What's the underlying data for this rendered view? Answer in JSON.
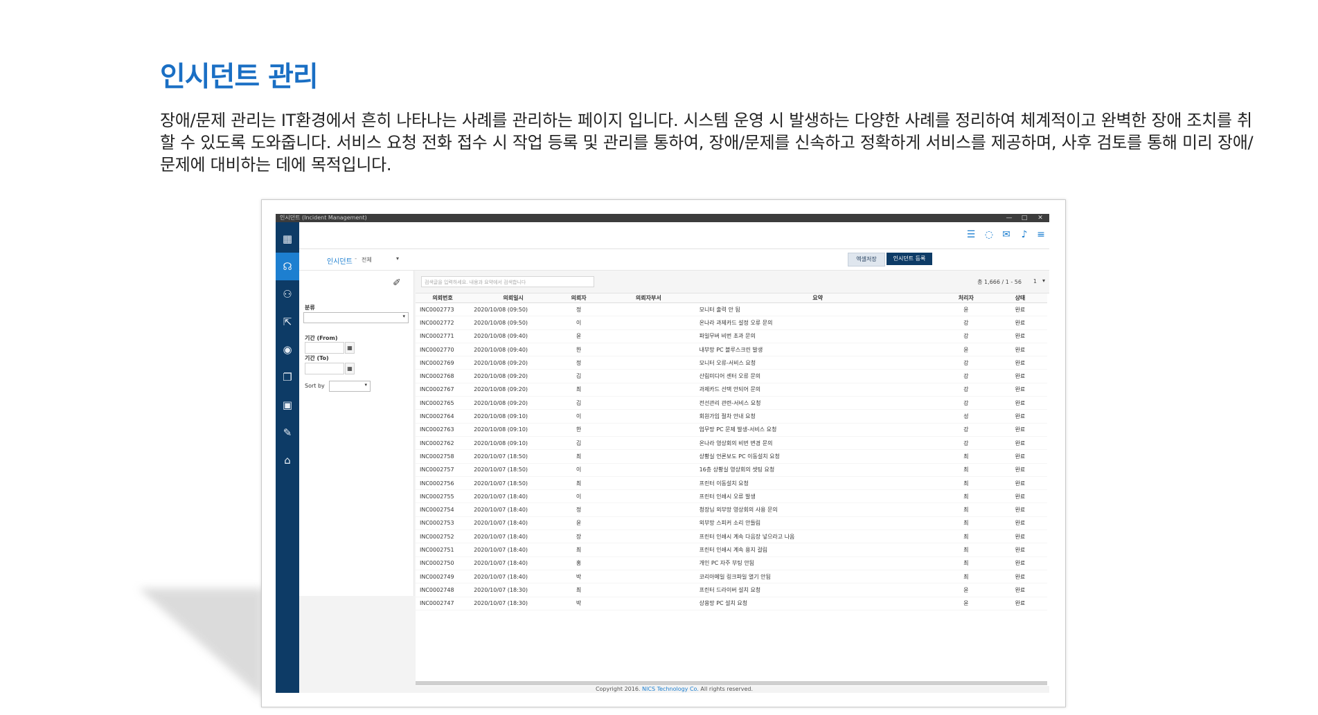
{
  "page": {
    "title": "인시던트 관리",
    "description": "장애/문제 관리는 IT환경에서 흔히 나타나는 사례를 관리하는 페이지 입니다. 시스템 운영 시 발생하는 다양한 사례를 정리하여 체계적이고 완벽한 장애 조치를 취할 수 있도록 도와줍니다. 서비스 요청 전화 접수 시 작업 등록 및 관리를 통하여, 장애/문제를 신속하고 정확하게 서비스를 제공하며, 사후 검토를 통해 미리 장애/ 문제에 대비하는 데에 목적입니다."
  },
  "app": {
    "window_title": "인시던트 (Incident Management)",
    "window_controls": [
      "—",
      "□",
      "✕"
    ],
    "sidebar": [
      {
        "icon": "calendar-icon",
        "glyph": "▦"
      },
      {
        "icon": "headset-icon",
        "glyph": "☊"
      },
      {
        "icon": "users-chat-icon",
        "glyph": "⚇"
      },
      {
        "icon": "external-link-icon",
        "glyph": "⇱"
      },
      {
        "icon": "eye-icon",
        "glyph": "◉"
      },
      {
        "icon": "copy-icon",
        "glyph": "❐"
      },
      {
        "icon": "grid-icon",
        "glyph": "▣"
      },
      {
        "icon": "edit-icon",
        "glyph": "✎"
      },
      {
        "icon": "bank-icon",
        "glyph": "⌂"
      }
    ],
    "top_icons": [
      {
        "icon": "task-list-icon",
        "glyph": "☰"
      },
      {
        "icon": "message-icon",
        "glyph": "◌"
      },
      {
        "icon": "mail-icon",
        "glyph": "✉"
      },
      {
        "icon": "bell-icon",
        "glyph": "♪"
      },
      {
        "icon": "menu-icon",
        "glyph": "≡"
      }
    ],
    "breadcrumb": {
      "main": "인시던트",
      "sep": "-",
      "sub": "전체",
      "caret": "▾"
    },
    "buttons": {
      "excel": "엑셀저장",
      "register": "인시던트 등록"
    },
    "filter": {
      "eraser_glyph": "✐",
      "category_label": "분류",
      "from_label": "기간 (From)",
      "to_label": "기간 (To)",
      "sort_label": "Sort by",
      "calendar_glyph": "▦",
      "caret": "▾"
    },
    "search": {
      "placeholder": "검색글을 입력하세요. 내용과 요약에서 검색합니다"
    },
    "pagination": {
      "info": "총 1,666 / 1 - 56",
      "current": "1",
      "caret": "▾"
    },
    "table": {
      "headers": [
        "의뢰번호",
        "의뢰일시",
        "의뢰자",
        "의뢰자부서",
        "요약",
        "처리자",
        "상태"
      ],
      "rows": [
        [
          "INC0002773",
          "2020/10/08 (09:50)",
          "정",
          "",
          "모니터 출력 안 됨",
          "윤",
          "완료"
        ],
        [
          "INC0002772",
          "2020/10/08 (09:50)",
          "이",
          "",
          "온나라 과제카드 설정 오류 문의",
          "강",
          "완료"
        ],
        [
          "INC0002771",
          "2020/10/08 (09:40)",
          "윤",
          "",
          "파일무버 비번 초과 문의",
          "강",
          "완료"
        ],
        [
          "INC0002770",
          "2020/10/08 (09:40)",
          "한",
          "",
          "내부망 PC 블루스크린 발생",
          "윤",
          "완료"
        ],
        [
          "INC0002769",
          "2020/10/08 (09:20)",
          "정",
          "",
          "모니터 오류-서비스 요청",
          "강",
          "완료"
        ],
        [
          "INC0002768",
          "2020/10/08 (09:20)",
          "김",
          "",
          "산림미디어 센터 오류 문의",
          "강",
          "완료"
        ],
        [
          "INC0002767",
          "2020/10/08 (09:20)",
          "최",
          "",
          "과제카드 선택 안되어 문의",
          "강",
          "완료"
        ],
        [
          "INC0002765",
          "2020/10/08 (09:20)",
          "김",
          "",
          "전선관리 관련-서비스 요청",
          "강",
          "완료"
        ],
        [
          "INC0002764",
          "2020/10/08 (09:10)",
          "이",
          "",
          "회원가입 절차 안내 요청",
          "성",
          "완료"
        ],
        [
          "INC0002763",
          "2020/10/08 (09:10)",
          "한",
          "",
          "업무망 PC 문제 발생-서비스 요청",
          "강",
          "완료"
        ],
        [
          "INC0002762",
          "2020/10/08 (09:10)",
          "김",
          "",
          "온나라 영상회의 비번 변경 문의",
          "강",
          "완료"
        ],
        [
          "INC0002758",
          "2020/10/07 (18:50)",
          "최",
          "",
          "상황실 언론보도 PC 이동설치 요청",
          "최",
          "완료"
        ],
        [
          "INC0002757",
          "2020/10/07 (18:50)",
          "이",
          "",
          "16층 상황실 영상회의 셋팅 요청",
          "최",
          "완료"
        ],
        [
          "INC0002756",
          "2020/10/07 (18:50)",
          "최",
          "",
          "프린터 이동설치 요청",
          "최",
          "완료"
        ],
        [
          "INC0002755",
          "2020/10/07 (18:40)",
          "이",
          "",
          "프린터 인쇄시 오류 발생",
          "최",
          "완료"
        ],
        [
          "INC0002754",
          "2020/10/07 (18:40)",
          "정",
          "",
          "청장님 외부망 영상회의 사용 문의",
          "최",
          "완료"
        ],
        [
          "INC0002753",
          "2020/10/07 (18:40)",
          "윤",
          "",
          "외부망 스피커 소리 안들림",
          "최",
          "완료"
        ],
        [
          "INC0002752",
          "2020/10/07 (18:40)",
          "장",
          "",
          "프린터 인쇄시 계속 다음장 넣으라고 나옴",
          "최",
          "완료"
        ],
        [
          "INC0002751",
          "2020/10/07 (18:40)",
          "최",
          "",
          "프린터 인쇄시 계속 용지 걸림",
          "최",
          "완료"
        ],
        [
          "INC0002750",
          "2020/10/07 (18:40)",
          "홍",
          "",
          "개인 PC 자주 부팅 안됨",
          "최",
          "완료"
        ],
        [
          "INC0002749",
          "2020/10/07 (18:40)",
          "박",
          "",
          "코리아메일 링크파일 열기 안됨",
          "최",
          "완료"
        ],
        [
          "INC0002748",
          "2020/10/07 (18:30)",
          "최",
          "",
          "프린터 드라이버 설치 요청",
          "윤",
          "완료"
        ],
        [
          "INC0002747",
          "2020/10/07 (18:30)",
          "박",
          "",
          "상용망 PC 설치 요청",
          "윤",
          "완료"
        ]
      ]
    },
    "footer": {
      "prefix": "Copyright 2016.",
      "company": "NICS Technology Co.",
      "suffix": "All rights reserved."
    }
  }
}
